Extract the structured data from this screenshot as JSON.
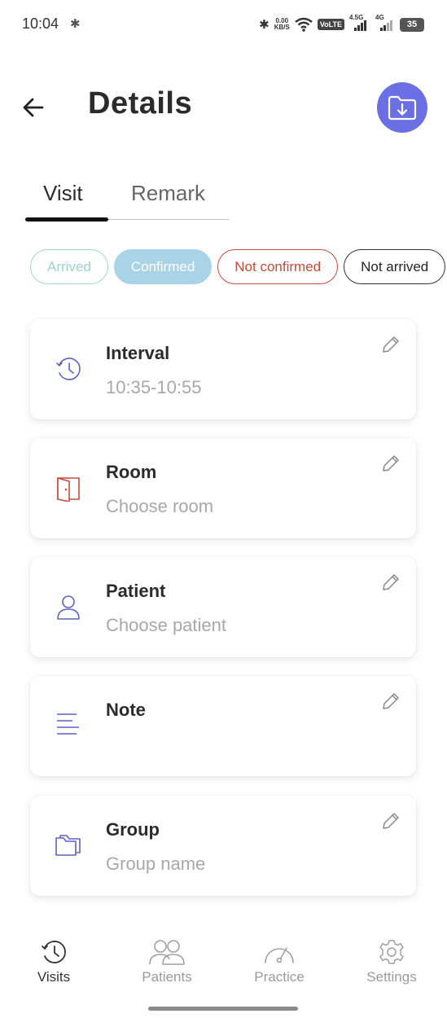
{
  "status_bar": {
    "time": "10:04",
    "net_speed_top": "0.00",
    "net_speed_bottom": "KB/S",
    "volte": "VoLTE",
    "sim1_label": "4.5G",
    "sim2_label": "4G",
    "battery": "35"
  },
  "header": {
    "title": "Details"
  },
  "tabs": [
    {
      "label": "Visit",
      "active": true
    },
    {
      "label": "Remark",
      "active": false
    }
  ],
  "status_chips": [
    {
      "label": "Arrived",
      "selected": false
    },
    {
      "label": "Confirmed",
      "selected": true
    },
    {
      "label": "Not confirmed",
      "selected": false
    },
    {
      "label": "Not arrived",
      "selected": false
    }
  ],
  "cards": [
    {
      "title": "Interval",
      "value": "10:35-10:55",
      "icon": "clock-icon",
      "icon_color": "#5b64c7"
    },
    {
      "title": "Room",
      "value": "Choose room",
      "icon": "door-icon",
      "icon_color": "#c94a3a"
    },
    {
      "title": "Patient",
      "value": "Choose patient",
      "icon": "person-icon",
      "icon_color": "#5b64c7"
    },
    {
      "title": "Note",
      "value": "",
      "icon": "lines-icon",
      "icon_color": "#5b64c7"
    },
    {
      "title": "Group",
      "value": "Group name",
      "icon": "folder-icon",
      "icon_color": "#5b64c7"
    }
  ],
  "bottom_nav": [
    {
      "label": "Visits",
      "icon": "clock-icon",
      "active": true
    },
    {
      "label": "Patients",
      "icon": "people-icon",
      "active": false
    },
    {
      "label": "Practice",
      "icon": "gauge-icon",
      "active": false
    },
    {
      "label": "Settings",
      "icon": "gear-icon",
      "active": false
    }
  ],
  "colors": {
    "accent": "#6b6fe4",
    "confirmed": "#a9d3e7",
    "arrived": "#9fd8c9",
    "not_confirmed": "#c94a3a"
  }
}
